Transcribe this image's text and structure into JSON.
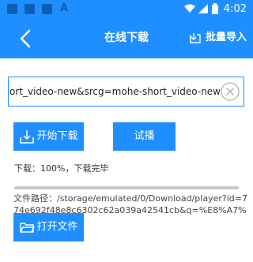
{
  "status_bar": {
    "time": "4:02",
    "icons": [
      "notification-icon",
      "notification-icon",
      "notification-icon",
      "font-icon",
      "wifi-icon",
      "signal-icon",
      "battery-icon"
    ],
    "background": "#1f8fff"
  },
  "app_bar": {
    "title": "在线下载",
    "back_icon": "back-arrow-icon",
    "import_label": "批量导入",
    "import_icon": "import-icon"
  },
  "url_input": {
    "value": "ohe-short_video-new&srcg=mohe-short_video-new",
    "clear_icon": "clear-icon"
  },
  "buttons": {
    "download_label": "开始下载",
    "play_label": "试播",
    "open_file_label": "打开文件"
  },
  "download": {
    "status_text": "下载：100%，下载完毕",
    "progress": 1.0,
    "file_path": "文件路径：/storage/emulated/0/Download/player?id=774e692f48e8c6302c62a039a42541cb&q=%E8%A7%"
  },
  "colors": {
    "accent": "#1f8fff"
  }
}
